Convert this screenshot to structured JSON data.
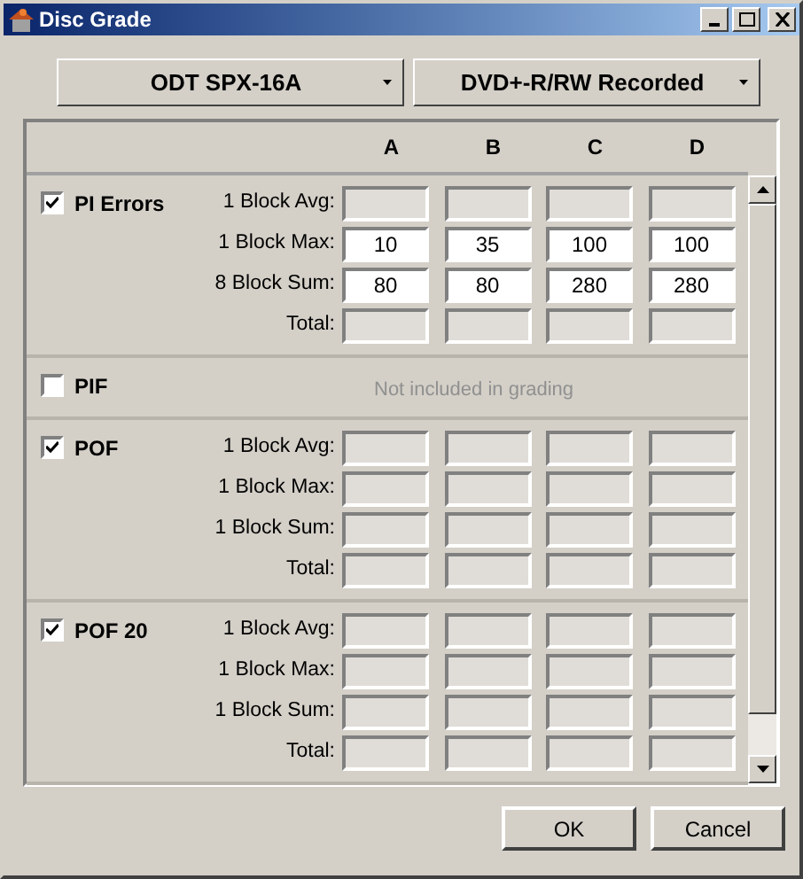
{
  "window": {
    "title": "Disc Grade"
  },
  "dropdowns": [
    {
      "value": "ODT SPX-16A"
    },
    {
      "value": "DVD+-R/RW Recorded"
    }
  ],
  "columns": [
    "A",
    "B",
    "C",
    "D"
  ],
  "sections": [
    {
      "label": "PI Errors",
      "checked": true,
      "kind": "fields",
      "rows": [
        {
          "label": "1 Block Avg:",
          "enabled": false
        },
        {
          "label": "1 Block Max:",
          "enabled": true,
          "values": [
            "10",
            "35",
            "100",
            "100"
          ]
        },
        {
          "label": "8 Block Sum:",
          "enabled": true,
          "values": [
            "80",
            "80",
            "280",
            "280"
          ]
        },
        {
          "label": "Total:",
          "enabled": false
        }
      ]
    },
    {
      "label": "PIF",
      "checked": false,
      "kind": "note",
      "note": "Not included in grading"
    },
    {
      "label": "POF",
      "checked": true,
      "kind": "fields",
      "rows": [
        {
          "label": "1 Block Avg:",
          "enabled": false
        },
        {
          "label": "1 Block Max:",
          "enabled": false
        },
        {
          "label": "1 Block Sum:",
          "enabled": false
        },
        {
          "label": "Total:",
          "enabled": false
        }
      ]
    },
    {
      "label": "POF 20",
      "checked": true,
      "kind": "fields",
      "rows": [
        {
          "label": "1 Block Avg:",
          "enabled": false
        },
        {
          "label": "1 Block Max:",
          "enabled": false
        },
        {
          "label": "1 Block Sum:",
          "enabled": false
        },
        {
          "label": "Total:",
          "enabled": false
        }
      ]
    }
  ],
  "buttons": [
    "OK",
    "Cancel"
  ]
}
